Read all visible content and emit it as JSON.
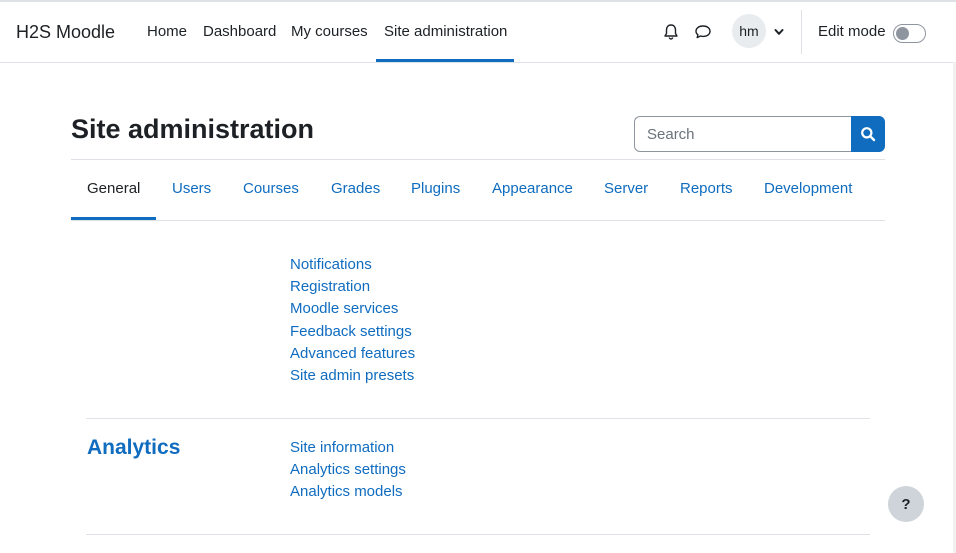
{
  "navbar": {
    "brand": "H2S Moodle",
    "links": [
      "Home",
      "Dashboard",
      "My courses",
      "Site administration"
    ],
    "active_link": "Site administration",
    "avatar_initials": "hm",
    "edit_mode_label": "Edit mode",
    "edit_mode_on": false,
    "icons": [
      "bell-icon",
      "chat-icon",
      "chevron-down-icon"
    ]
  },
  "page": {
    "title": "Site administration"
  },
  "search": {
    "placeholder": "Search",
    "value": ""
  },
  "tabs": {
    "items": [
      "General",
      "Users",
      "Courses",
      "Grades",
      "Plugins",
      "Appearance",
      "Server",
      "Reports",
      "Development"
    ],
    "active": "General"
  },
  "general_section": {
    "links": [
      "Notifications",
      "Registration",
      "Moodle services",
      "Feedback settings",
      "Advanced features",
      "Site admin presets"
    ]
  },
  "analytics_section": {
    "heading": "Analytics",
    "links": [
      "Site information",
      "Analytics settings",
      "Analytics models"
    ]
  },
  "help": {
    "label": "?"
  },
  "colors": {
    "accent": "#0f6cbf",
    "text": "#1d2125",
    "border": "#dee2e6"
  }
}
